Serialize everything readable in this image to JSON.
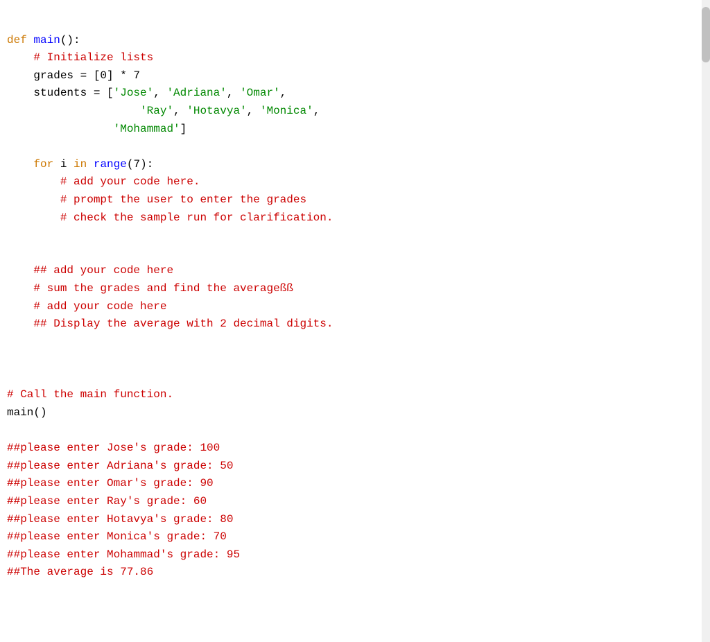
{
  "code": {
    "lines": [
      {
        "type": "mixed",
        "id": "line1"
      },
      {
        "type": "mixed",
        "id": "line2"
      },
      {
        "type": "mixed",
        "id": "line3"
      },
      {
        "type": "mixed",
        "id": "line4"
      },
      {
        "type": "mixed",
        "id": "line5"
      },
      {
        "type": "mixed",
        "id": "line6"
      },
      {
        "type": "blank",
        "id": "line7"
      },
      {
        "type": "mixed",
        "id": "line8"
      },
      {
        "type": "comment",
        "id": "line9"
      },
      {
        "type": "comment",
        "id": "line10"
      },
      {
        "type": "comment",
        "id": "line11"
      },
      {
        "type": "blank",
        "id": "line12"
      },
      {
        "type": "blank",
        "id": "line13"
      },
      {
        "type": "comment",
        "id": "line14"
      },
      {
        "type": "comment",
        "id": "line15"
      },
      {
        "type": "comment",
        "id": "line16"
      },
      {
        "type": "comment",
        "id": "line17"
      },
      {
        "type": "blank",
        "id": "line18"
      },
      {
        "type": "blank",
        "id": "line19"
      },
      {
        "type": "blank",
        "id": "line20"
      },
      {
        "type": "comment",
        "id": "line21"
      },
      {
        "type": "plain",
        "id": "line22"
      },
      {
        "type": "blank",
        "id": "line23"
      },
      {
        "type": "output",
        "id": "line24"
      },
      {
        "type": "output",
        "id": "line25"
      },
      {
        "type": "output",
        "id": "line26"
      },
      {
        "type": "output",
        "id": "line27"
      },
      {
        "type": "output",
        "id": "line28"
      },
      {
        "type": "output",
        "id": "line29"
      },
      {
        "type": "output",
        "id": "line30"
      },
      {
        "type": "output",
        "id": "line31"
      }
    ]
  }
}
